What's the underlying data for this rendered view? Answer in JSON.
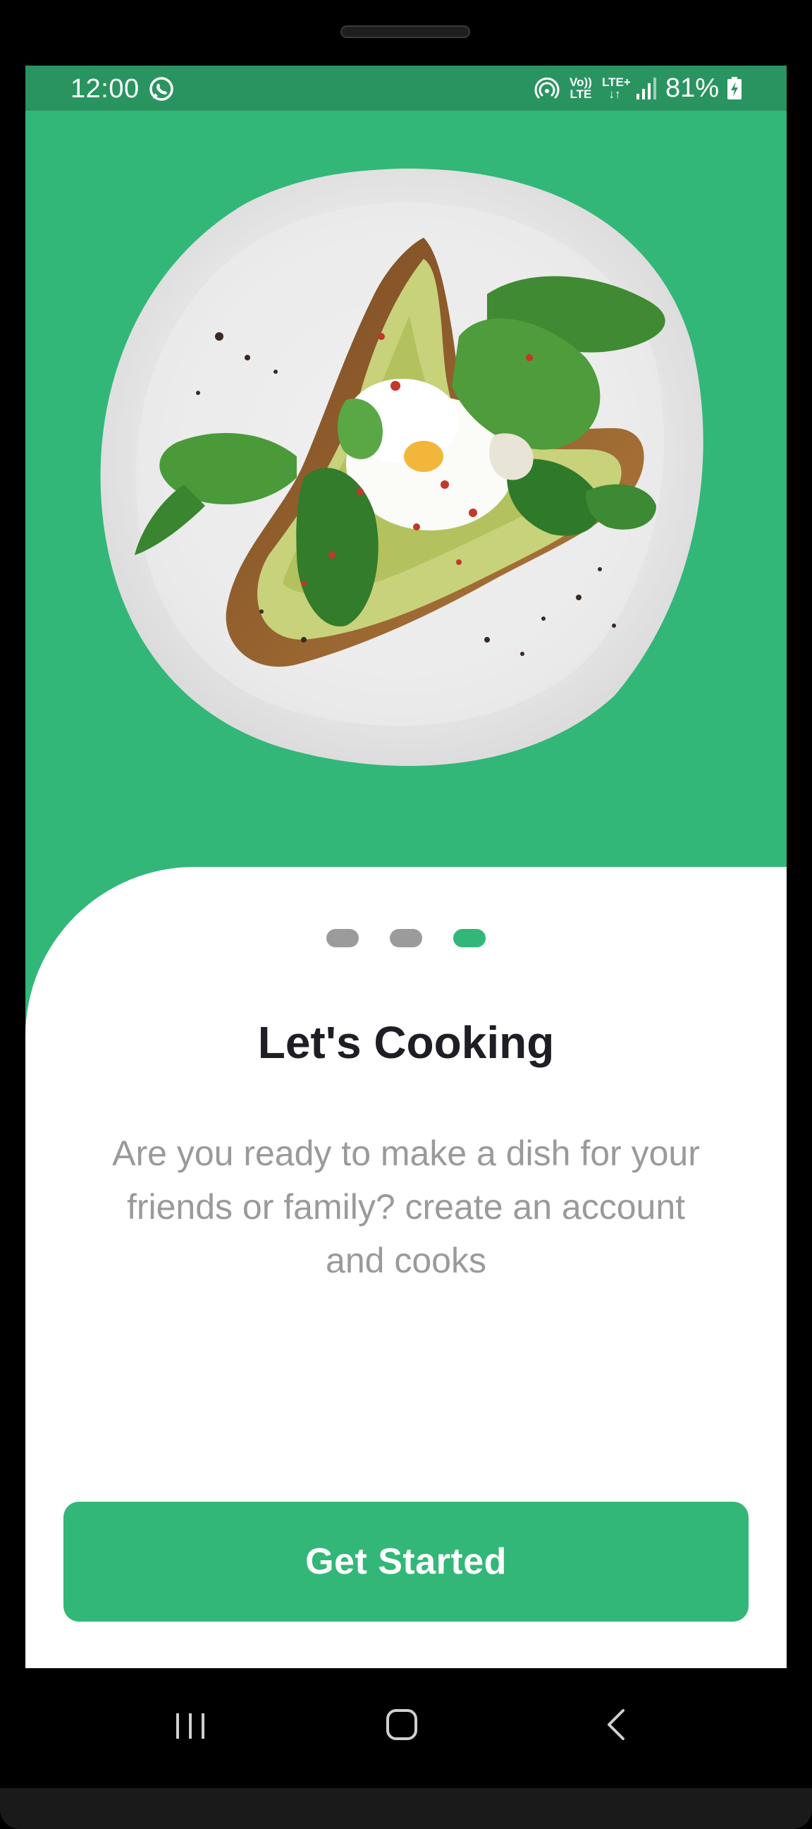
{
  "status_bar": {
    "time": "12:00",
    "volte_top": "Vo))",
    "volte_bottom": "LTE",
    "lte_top": "LTE+",
    "lte_bottom": "↓↑",
    "battery": "81%"
  },
  "onboarding": {
    "pages_total": 3,
    "current_page": 3,
    "title": "Let's Cooking",
    "description": "Are you ready to make a dish for your friends or family? create an account and cooks",
    "cta_label": "Get Started"
  },
  "colors": {
    "primary": "#32b778",
    "status_bar": "#2a9460",
    "title": "#1e1e24",
    "description": "#9a9a9a",
    "dot_inactive": "#9b9b9b"
  },
  "icons": {
    "status": [
      "whatsapp-icon",
      "hotspot-icon",
      "signal-icon",
      "battery-charging-icon"
    ],
    "navigation": [
      "recents-icon",
      "home-icon",
      "back-icon"
    ],
    "hero": "plate-avocado-toast-image"
  }
}
